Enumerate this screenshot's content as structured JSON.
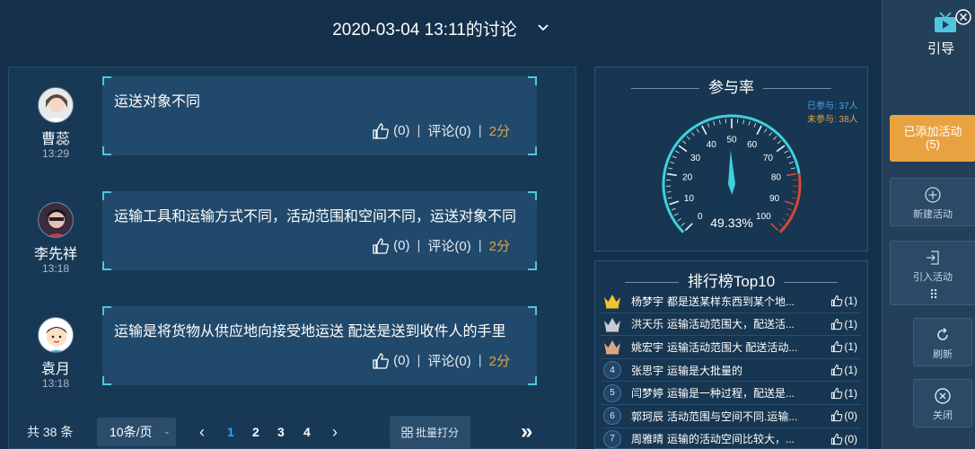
{
  "header": {
    "title": "2020-03-04 13:11的讨论",
    "dropdown_icon": "chevron-down-icon"
  },
  "posts": [
    {
      "name": "曹蕊",
      "time": "13:29",
      "text": "运送对象不同",
      "likes": "(0)",
      "sep": "|",
      "comment": "评论(0)",
      "score": "2分"
    },
    {
      "name": "李先祥",
      "time": "13:18",
      "text": "运输工具和运输方式不同，活动范围和空间不同，运送对象不同",
      "likes": "(0)",
      "sep": "|",
      "comment": "评论(0)",
      "score": "2分"
    },
    {
      "name": "袁月",
      "time": "13:18",
      "text": "运输是将货物从供应地向接受地运送 配送是送到收件人的手里",
      "likes": "(0)",
      "sep": "|",
      "comment": "评论(0)",
      "score": "2分"
    }
  ],
  "pager": {
    "total": "共 38 条",
    "page_size": "10条/页",
    "pages": [
      "1",
      "2",
      "3",
      "4"
    ],
    "current_page": "1",
    "batch_label": "批量打分"
  },
  "participation": {
    "title": "参与率",
    "joined_label": "已参与: 37人",
    "not_joined_label": "未参与: 38人",
    "rate_text": "49.33%",
    "rate_value": 49.33,
    "ticks": [
      "0",
      "10",
      "20",
      "30",
      "40",
      "50",
      "60",
      "70",
      "80",
      "90",
      "100"
    ]
  },
  "ranking": {
    "title": "排行榜Top10",
    "items": [
      {
        "rank": "1",
        "medal": "gold",
        "name": "杨梦宇",
        "content": "都是送某样东西到某个地...",
        "likes": "(1)"
      },
      {
        "rank": "2",
        "medal": "silver",
        "name": "洪天乐",
        "content": "运输活动范围大，配送活...",
        "likes": "(1)"
      },
      {
        "rank": "3",
        "medal": "bronze",
        "name": "姚宏宇",
        "content": "运输活动范围大 配送活动...",
        "likes": "(1)"
      },
      {
        "rank": "4",
        "medal": "",
        "name": "张思宇",
        "content": "运输是大批量的",
        "likes": "(1)"
      },
      {
        "rank": "5",
        "medal": "",
        "name": "闫梦婷",
        "content": "运输是一种过程，配送是...",
        "likes": "(1)"
      },
      {
        "rank": "6",
        "medal": "",
        "name": "郭珂辰",
        "content": "活动范围与空间不同.运输...",
        "likes": "(0)"
      },
      {
        "rank": "7",
        "medal": "",
        "name": "周雅晴",
        "content": "运输的活动空间比较大，...",
        "likes": "(0)"
      }
    ]
  },
  "sidebar": {
    "guide_label": "引导",
    "added_activity": "已添加活动",
    "added_count": "(5)",
    "new_activity": "新建活动",
    "import_activity": "引入活动",
    "refresh": "刷新",
    "close": "关闭"
  },
  "colors": {
    "accent": "#2fa7f2",
    "score": "#e2a248",
    "added_button": "#e9a240",
    "gauge": "#3fd0e0"
  }
}
